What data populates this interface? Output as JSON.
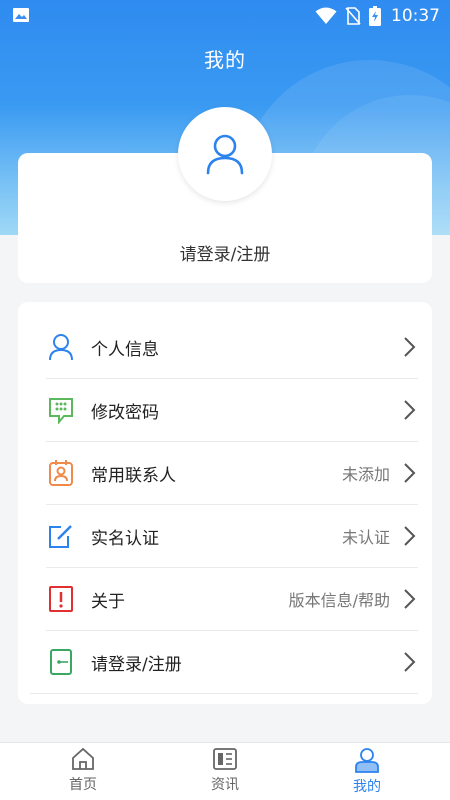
{
  "status_bar": {
    "time": "10:37"
  },
  "page_title": "我的",
  "profile": {
    "login_text": "请登录/注册"
  },
  "menu": [
    {
      "label": "个人信息",
      "value": "",
      "icon": "person-icon"
    },
    {
      "label": "修改密码",
      "value": "",
      "icon": "password-icon"
    },
    {
      "label": "常用联系人",
      "value": "未添加",
      "icon": "contact-card-icon"
    },
    {
      "label": "实名认证",
      "value": "未认证",
      "icon": "edit-verify-icon"
    },
    {
      "label": "关于",
      "value": "版本信息/帮助",
      "icon": "info-alert-icon"
    },
    {
      "label": "请登录/注册",
      "value": "",
      "icon": "login-door-icon"
    }
  ],
  "tabs": [
    {
      "label": "首页",
      "icon": "home-icon"
    },
    {
      "label": "资讯",
      "icon": "news-icon"
    },
    {
      "label": "我的",
      "icon": "profile-icon"
    }
  ],
  "colors": {
    "primary": "#2d83ee",
    "header_gradient_top": "#2f8bf0",
    "header_gradient_bottom": "#9fd8f6"
  }
}
